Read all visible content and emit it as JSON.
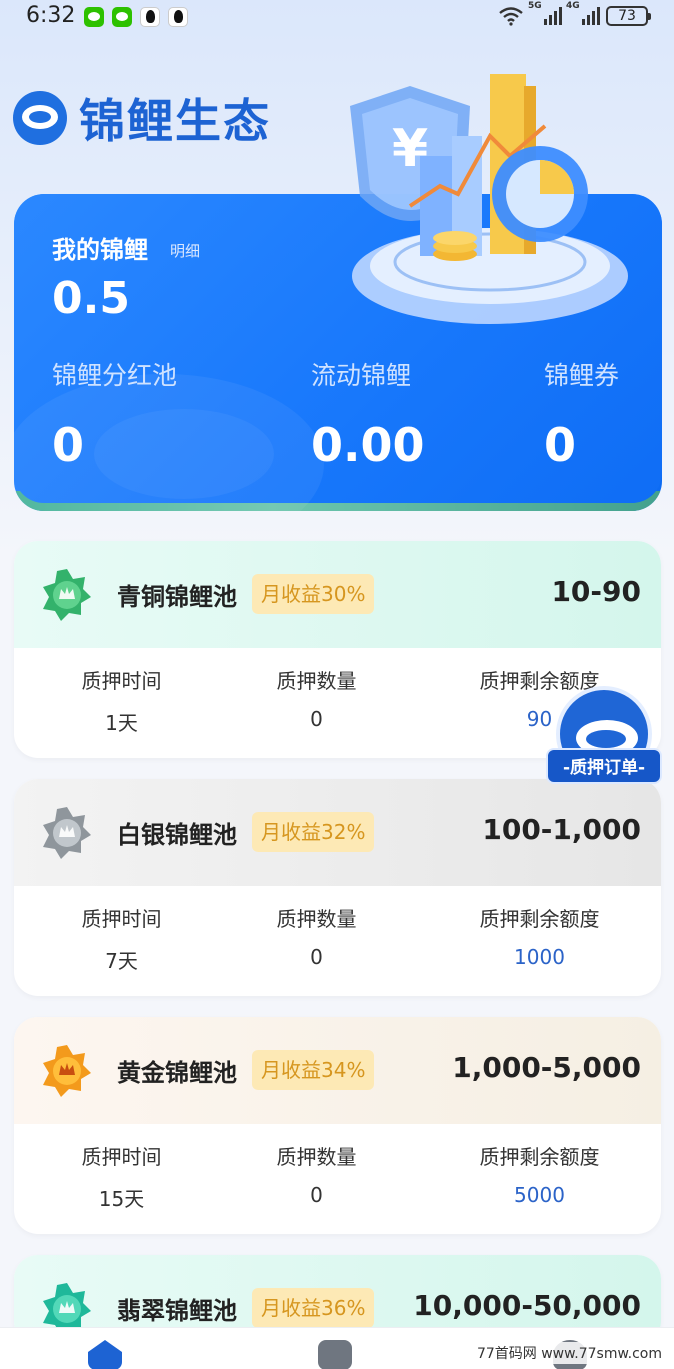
{
  "status_bar": {
    "time": "6:32",
    "net1": "5G",
    "net2": "4G",
    "battery": "73"
  },
  "header": {
    "brand": "锦鲤生态"
  },
  "hero": {
    "my_label": "我的锦鲤",
    "detail_link": "明细",
    "my_value": "0.5",
    "stats": [
      {
        "label": "锦鲤分红池",
        "value": "0"
      },
      {
        "label": "流动锦鲤",
        "value": "0.00"
      },
      {
        "label": "锦鲤券",
        "value": "0"
      }
    ]
  },
  "pools": [
    {
      "name": "青铜锦鲤池",
      "tag": "月收益30%",
      "range": "10-90",
      "time_label": "质押时间",
      "time": "1天",
      "count_label": "质押数量",
      "count": "0",
      "quota_label": "质押剩余额度",
      "quota": "90",
      "head_color": "#d6f7ee",
      "badge_color": "#33b26b"
    },
    {
      "name": "白银锦鲤池",
      "tag": "月收益32%",
      "range": "100-1,000",
      "time_label": "质押时间",
      "time": "7天",
      "count_label": "质押数量",
      "count": "0",
      "quota_label": "质押剩余额度",
      "quota": "1000",
      "head_color": "#ececec",
      "badge_color": "#8f969c"
    },
    {
      "name": "黄金锦鲤池",
      "tag": "月收益34%",
      "range": "1,000-5,000",
      "time_label": "质押时间",
      "time": "15天",
      "count_label": "质押数量",
      "count": "0",
      "quota_label": "质押剩余额度",
      "quota": "5000",
      "head_color": "#fbf2e8",
      "badge_color": "#f39a1c"
    },
    {
      "name": "翡翠锦鲤池",
      "tag": "月收益36%",
      "range": "10,000-50,000",
      "head_color": "#d6f7ee",
      "badge_color": "#1fb89a"
    }
  ],
  "float_button": {
    "label": "-质押订单-"
  },
  "watermark": "77首码网 www.77smw.com",
  "colors": {
    "primary": "#1677ff",
    "brand_text": "#1d63d3",
    "tag_bg": "#fde9b5",
    "tag_text": "#d6961f",
    "quota_blue": "#2b63c8"
  }
}
